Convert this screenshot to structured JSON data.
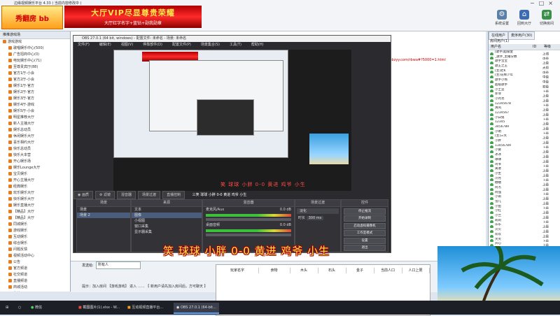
{
  "window": {
    "title": "边缘视频娱乐平台 4.33 ( 当前内容修改中 )"
  },
  "banner": {
    "logo_text": "秀翻房 bb",
    "line1": "大厅VIP尽显尊贵荣耀",
    "line2": "大厅红字名字+蓝钻+勋我勋章"
  },
  "toolbar": {
    "buttons": [
      {
        "label": "系统设置",
        "color": "#5a7fa8"
      },
      {
        "label": "回到大厅",
        "color": "#3d6bb0"
      },
      {
        "label": "切换房间",
        "color": "#3a8f4a"
      }
    ]
  },
  "left_panel": {
    "header": "推推游戏场",
    "items": [
      "游戏游戏",
      "歌唱娱乐中心(500)",
      "广告招商中心(0)",
      "电玩娱乐中心(71)",
      "至尊贵宾厅(88)",
      "官方1厅-小会",
      "官方2厅-小会",
      "娱乐1厅-官方",
      "娱乐2厅-官方",
      "娱乐3厅-官方",
      "娱乐4厅-游戏",
      "娱乐5厅-小会",
      "明星推荐大厅",
      "新人主播大厅",
      "娱乐总动员",
      "休闲娱乐大厅",
      "喜乐相约大厅",
      "快乐总动员",
      "快乐大本营",
      "开心娱乐场",
      "娱乐Lounge大厅",
      "宝贝娱乐",
      "开心主播大厅",
      "经典娱乐",
      "欢乐娱乐大厅",
      "快乐娱乐大厅",
      "娱乐直播大厅",
      "【精品】大厅",
      "【精品】大厅",
      "同城娱乐",
      "游戏娱乐",
      "互动娱乐",
      "综合娱乐",
      "问题反馈",
      "视频活动中心",
      "公告",
      "官方频道",
      "社交频道",
      "直播频道",
      "商城活动",
      "其他"
    ]
  },
  "chat": {
    "link_text": "http://www.jmlbbzyy.com/rbwa#?5000=1.html"
  },
  "obs": {
    "title": "OBS 27.0.1 (64 bit, windows) - 配置文件: 未命名 - 场景: 未命名",
    "menu": [
      "文件(F)",
      "编辑(E)",
      "视图(V)",
      "停靠部件(D)",
      "配置文件(P)",
      "场景集合(S)",
      "工具(T)",
      "帮助(H)"
    ],
    "nick_overlay": "笑 球球 小胖 0-0 黄进 鸡爷 小生",
    "tabs": [
      "◉ 画质",
      "⚙ 滤镜",
      "混音器",
      "场景过渡",
      "直播控制"
    ],
    "tab_marquee": "三笑 球球 小胖 0-0 黄进 鸡爷 小生",
    "scenes_header": "场景",
    "scenes": [
      "场景",
      "场景 2"
    ],
    "sources_header": "来源",
    "sources": [
      "文本",
      "图像",
      "小视图",
      "窗口采集",
      "显示器采集"
    ],
    "mixer_header": "混音器",
    "mixer": [
      {
        "name": "麦克风/Aux",
        "db": "0.0 dB"
      },
      {
        "name": "桌面音频",
        "db": "0.0 dB"
      }
    ],
    "transition_header": "场景过渡",
    "transition": {
      "type": "淡化",
      "duration_label": "时长",
      "duration": "300 ms"
    },
    "controls_header": "控件",
    "controls": [
      "停止推流",
      "开始录制",
      "启动虚拟摄像机",
      "工作室模式",
      "设置",
      "退出"
    ]
  },
  "bottom": {
    "label": "发送给:",
    "select": "所有人",
    "status": "提示：加入房间 【游戏游戏】 进入 …… 【 新用户请先加入房间后，方可聊天 】",
    "nick_overlay": "笑 球球 小胖 0-0 黄进 鸡爷 小生"
  },
  "sheet": {
    "columns": [
      "玩家名字",
      "食物",
      "木头",
      "石头",
      "金子",
      "当前人口",
      "人口上限"
    ]
  },
  "right_panel": {
    "tabs": [
      "在线用户",
      "麦序用户(30)"
    ],
    "subhead": "房间用户(1)",
    "columns": [
      "用户名",
      "ID",
      "等级"
    ],
    "users": [
      {
        "name": "[歌手]超级金",
        "level": "上线"
      },
      {
        "name": "_歌手_主播分数",
        "level": "中级"
      },
      {
        "name": "歌手宝宝",
        "level": "上级"
      },
      {
        "name": "歌王之王",
        "level": "大师"
      },
      {
        "name": "[主]老K",
        "level": "中级"
      },
      {
        "name": "[主]花样少年",
        "level": "中级"
      },
      {
        "name": "歌手小熊",
        "level": "中级"
      },
      {
        "name": "超级歌手",
        "level": "初级"
      },
      {
        "name": "小土豆",
        "level": "上级"
      },
      {
        "name": "菲菲",
        "level": "上级"
      },
      {
        "name": "小月亮",
        "level": "上级"
      },
      {
        "name": "12345678",
        "level": "上级"
      },
      {
        "name": "清风",
        "level": "上级"
      },
      {
        "name": "1234567",
        "level": "上级"
      },
      {
        "name": "小白兔",
        "level": "上级"
      },
      {
        "name": "12345",
        "level": "上级"
      },
      {
        "name": "3456789",
        "level": "上级"
      },
      {
        "name": "小明",
        "level": "上级"
      },
      {
        "name": "[主]三笑",
        "level": "上级"
      },
      {
        "name": "小胖",
        "level": "上级"
      },
      {
        "name": "13456789",
        "level": "上级"
      },
      {
        "name": "小葵",
        "level": "上级"
      },
      {
        "name": "冰冰",
        "level": "上级"
      },
      {
        "name": "球球",
        "level": "上级"
      },
      {
        "name": "鸡爷",
        "level": "上级"
      },
      {
        "name": "黄进",
        "level": "上级"
      },
      {
        "name": "小生",
        "level": "上级"
      },
      {
        "name": "冷月",
        "level": "上级"
      },
      {
        "name": "糖糖",
        "level": "上级"
      },
      {
        "name": "阿杰",
        "level": "上级"
      },
      {
        "name": "阿强",
        "level": "上级"
      },
      {
        "name": "小雨",
        "level": "上级"
      },
      {
        "name": "雪儿",
        "level": "上级"
      },
      {
        "name": "小鱼",
        "level": "上级"
      },
      {
        "name": "小红",
        "level": "上级"
      },
      {
        "name": "小兰",
        "level": "上级"
      },
      {
        "name": "莉莉",
        "level": "上级"
      },
      {
        "name": "乐乐",
        "level": "上级"
      },
      {
        "name": "贝贝",
        "level": "上级"
      },
      {
        "name": "欢欢",
        "level": "上级"
      },
      {
        "name": "笑笑",
        "level": "上级"
      },
      {
        "name": "开心",
        "level": "上级"
      },
      {
        "name": "快乐",
        "level": "上级"
      },
      {
        "name": "天天",
        "level": "上级"
      },
      {
        "name": "阳阳",
        "level": "上级"
      },
      {
        "name": "飞飞",
        "level": "上级"
      },
      {
        "name": "豆豆",
        "level": "上级"
      },
      {
        "name": "宝宝",
        "level": "上级"
      }
    ]
  },
  "taskbar": {
    "items": [
      {
        "label": "微信",
        "active": false
      },
      {
        "label": "截图图片(1).xlsx - W...",
        "active": false
      },
      {
        "label": "互动视频直播平台...",
        "active": false
      },
      {
        "label": "OBS 27.0.1 (64-bit...",
        "active": true
      }
    ]
  }
}
